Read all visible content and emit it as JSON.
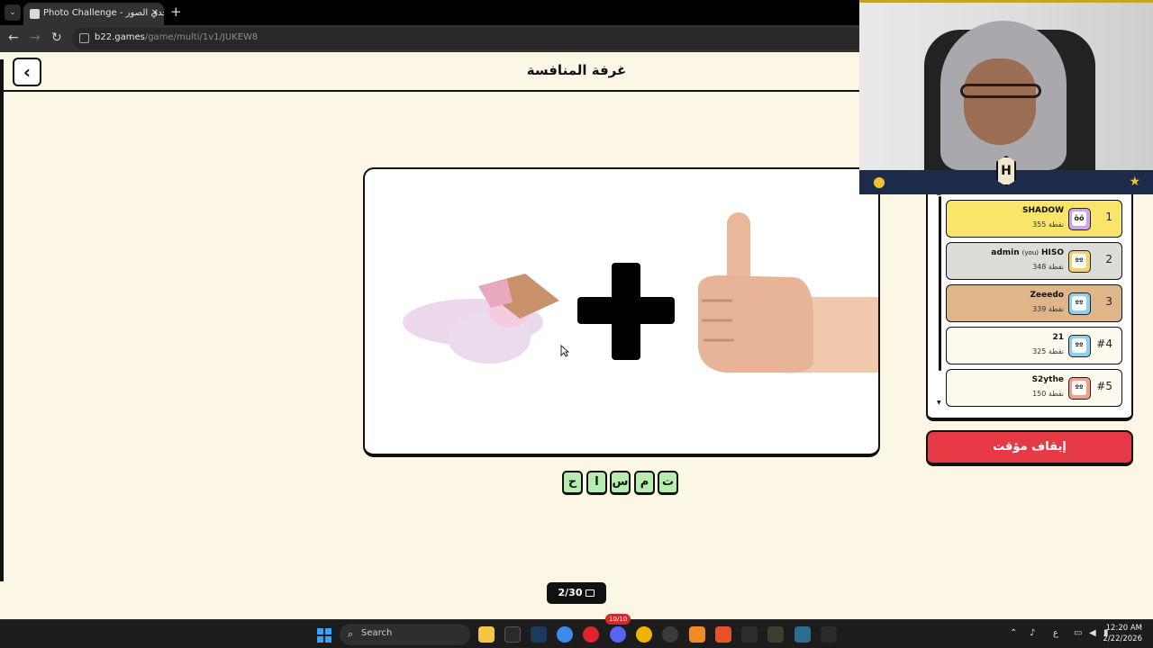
{
  "browser": {
    "tab_title": "Photo Challenge - تحدي الصور",
    "tab_close": "✕",
    "new_tab": "+",
    "url_domain": "b22.games",
    "url_path": "/game/multi/1v1/JUKEW8"
  },
  "header": {
    "back_icon": "‹",
    "title": "غرفة المنافسة"
  },
  "puzzle": {
    "letters": [
      "ت",
      "م",
      "س",
      "ا",
      "ح"
    ]
  },
  "leaderboard": [
    {
      "rank": "1",
      "name": "SHADOW",
      "you": "",
      "score": "355 نقطة",
      "bg": "#f9e56a",
      "avatar_bg": "#c8a6e8",
      "face": "òó"
    },
    {
      "rank": "2",
      "name": "admin",
      "you": "(you)",
      "name2": "HISO",
      "score": "348 نقطة",
      "bg": "#dcdcd8",
      "avatar_bg": "#f5d36b",
      "face": "ºº"
    },
    {
      "rank": "3",
      "name": "Zeeedo",
      "you": "",
      "score": "339 نقطة",
      "bg": "#dfb689",
      "avatar_bg": "#8fd0ef",
      "face": "ºº"
    },
    {
      "rank": "#4",
      "name": "21",
      "you": "",
      "score": "325 نقطة",
      "bg": "#fffaf0",
      "avatar_bg": "#8fd0ef",
      "face": "ºº"
    },
    {
      "rank": "#5",
      "name": "S2ythe",
      "you": "",
      "score": "150 نقطة",
      "bg": "#fffaf0",
      "avatar_bg": "#f3a08a",
      "face": "ºº"
    }
  ],
  "pause_button": "إيقاف مؤقت",
  "progress": {
    "label": "2/30",
    "current": 2,
    "total": 30
  },
  "taskbar": {
    "search_label": "Search",
    "badge": "10/10",
    "time": "12:20 AM",
    "date": "2/22/2026",
    "lang": "ع"
  },
  "colors": {
    "page_bg": "#fcf6e5",
    "letter_tile": "#b6ecae",
    "pause": "#e63946"
  }
}
